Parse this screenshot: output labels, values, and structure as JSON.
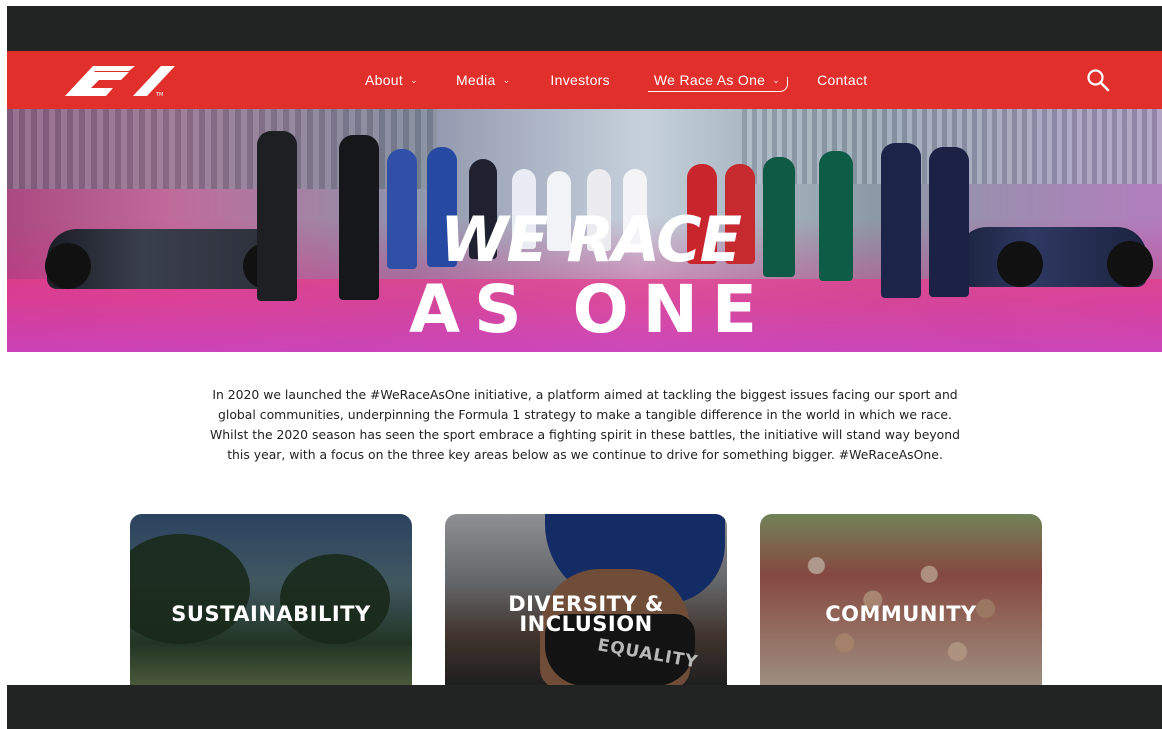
{
  "brand": {
    "logo_text": "F1",
    "trademark": "TM",
    "accent": "#e1302c",
    "dark_bar": "#222423"
  },
  "nav": {
    "items": [
      {
        "label": "About",
        "has_dropdown": true
      },
      {
        "label": "Media",
        "has_dropdown": true
      },
      {
        "label": "Investors",
        "has_dropdown": false
      },
      {
        "label": "We Race As One",
        "has_dropdown": true,
        "active": true
      },
      {
        "label": "Contact",
        "has_dropdown": false
      }
    ],
    "search_icon": "search-icon",
    "dropdown_glyph": "⌄"
  },
  "hero": {
    "line1": "WE RACE",
    "line2": "AS ONE"
  },
  "intro": {
    "text": "In 2020 we launched the #WeRaceAsOne initiative, a platform aimed at tackling the biggest issues facing our sport and global communities, underpinning the Formula 1 strategy to make a tangible difference in the world in which we race. Whilst the 2020 season has seen the sport embrace a fighting spirit in these battles, the initiative will stand way beyond this year, with a focus on the three key areas below as we continue to drive for something bigger. #WeRaceAsOne."
  },
  "cards": [
    {
      "title": "SUSTAINABILITY"
    },
    {
      "title_line1": "DIVERSITY &",
      "title_line2": "INCLUSION",
      "mask_text": "EQUALITY"
    },
    {
      "title": "COMMUNITY"
    }
  ]
}
